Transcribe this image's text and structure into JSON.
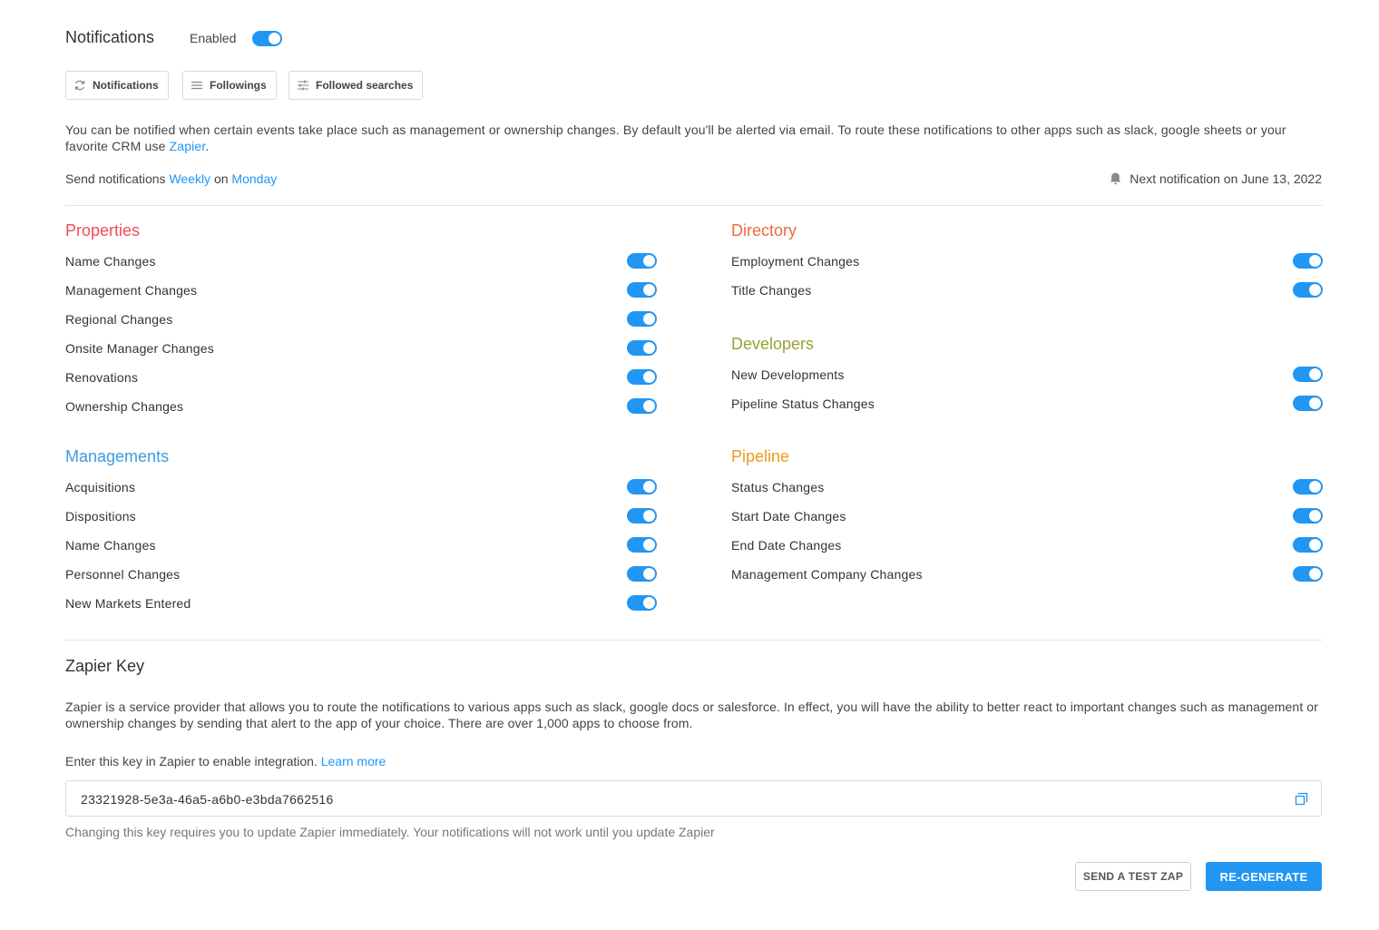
{
  "header": {
    "title": "Notifications",
    "enabled_label": "Enabled",
    "enabled": true
  },
  "tabs": [
    {
      "label": "Notifications",
      "icon": "refresh-icon"
    },
    {
      "label": "Followings",
      "icon": "list-icon"
    },
    {
      "label": "Followed searches",
      "icon": "sliders-icon"
    }
  ],
  "intro": {
    "text": "You can be notified when certain events take place such as management or ownership changes. By default you'll be alerted via email. To route these notifications to other apps such as slack, google sheets or your favorite CRM use ",
    "link": "Zapier",
    "end": "."
  },
  "schedule": {
    "prefix": "Send notifications ",
    "frequency": "Weekly",
    "on": " on ",
    "day": "Monday",
    "next_label": "Next notification on June 13, 2022"
  },
  "sections": {
    "properties": {
      "title": "Properties",
      "color": "#ef4b5a",
      "items": [
        "Name Changes",
        "Management Changes",
        "Regional Changes",
        "Onsite Manager Changes",
        "Renovations",
        "Ownership Changes"
      ]
    },
    "managements": {
      "title": "Managements",
      "color": "#3c9be0",
      "items": [
        "Acquisitions",
        "Dispositions",
        "Name Changes",
        "Personnel Changes",
        "New Markets Entered"
      ]
    },
    "directory": {
      "title": "Directory",
      "color": "#ee6a3c",
      "items": [
        "Employment Changes",
        "Title Changes"
      ]
    },
    "developers": {
      "title": "Developers",
      "color": "#9aa232",
      "items": [
        "New Developments",
        "Pipeline Status Changes"
      ]
    },
    "pipeline": {
      "title": "Pipeline",
      "color": "#ee9a1a",
      "items": [
        "Status Changes",
        "Start Date Changes",
        "End Date Changes",
        "Management Company Changes"
      ]
    }
  },
  "zapier": {
    "title": "Zapier Key",
    "description": "Zapier is a service provider that allows you to route the notifications to various apps such as slack, google docs or salesforce. In effect, you will have the ability to better react to important changes such as management or ownership changes by sending that alert to the app of your choice. There are over 1,000 apps to choose from.",
    "enter_text": "Enter this key in Zapier to enable integration. ",
    "learn_more": "Learn more",
    "key": "23321928-5e3a-46a5-a6b0-e3bda7662516",
    "hint": "Changing this key requires you to update Zapier immediately. Your notifications will not work until you update Zapier",
    "test_button": "SEND A TEST ZAP",
    "regen_button": "RE-GENERATE"
  },
  "colors": {
    "accent": "#2196f3"
  }
}
